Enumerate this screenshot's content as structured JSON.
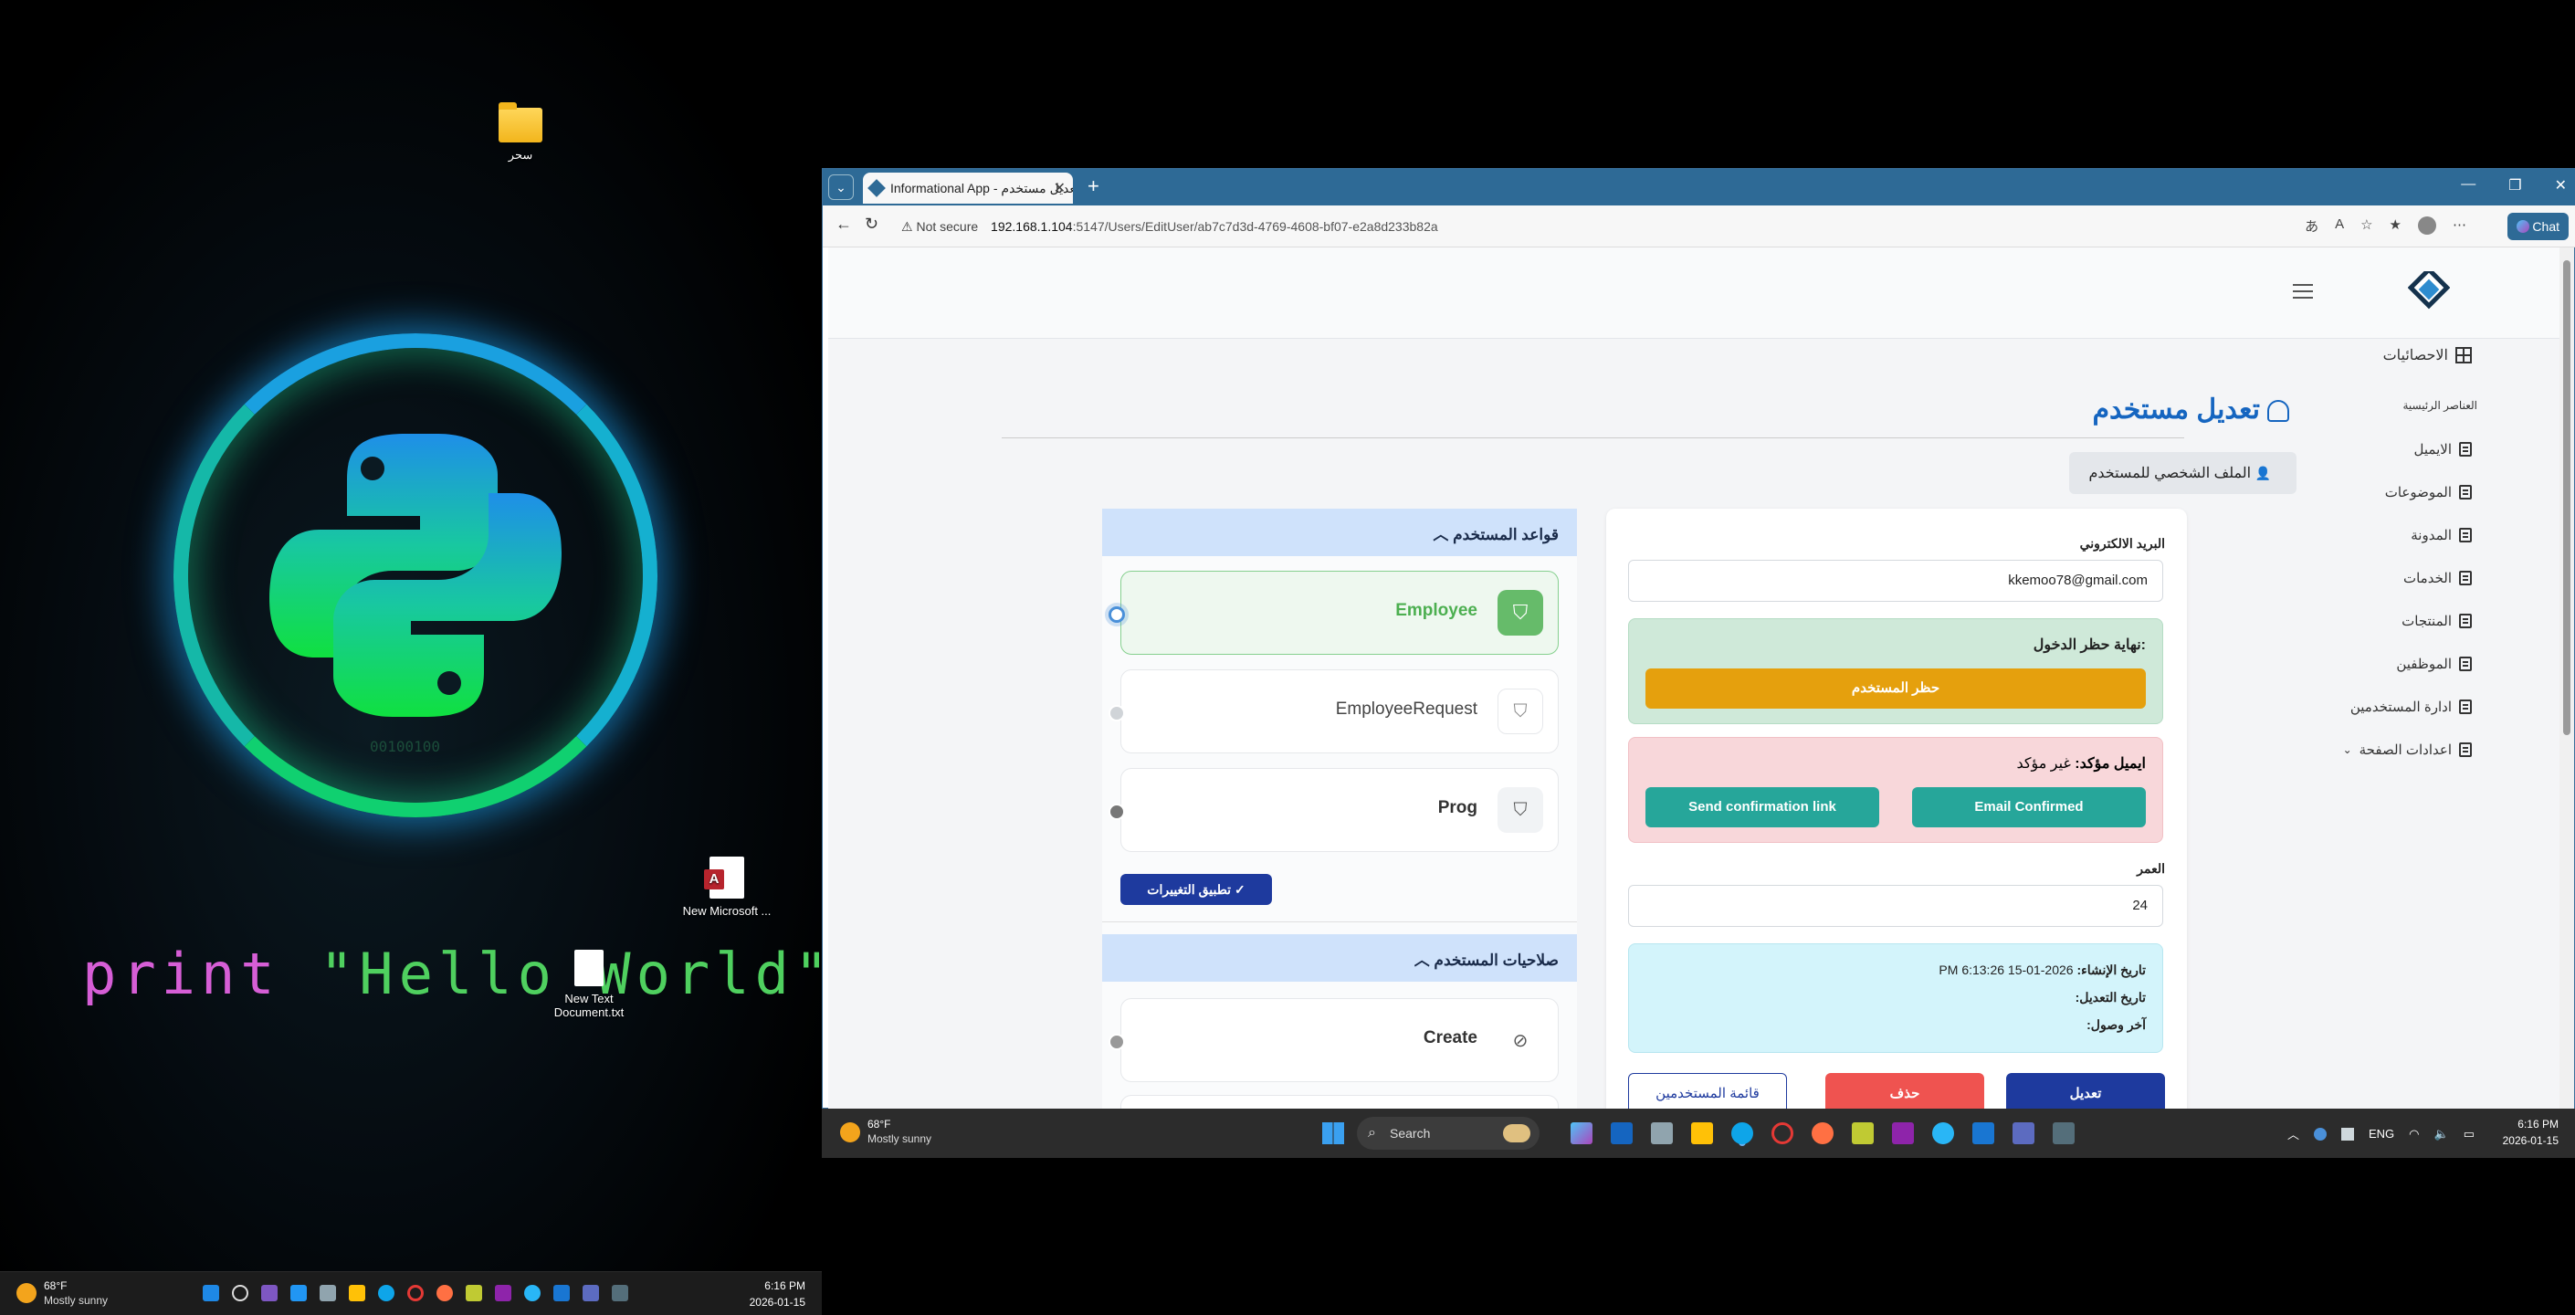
{
  "left_desktop": {
    "folder_label": "سحر",
    "code_text": "print ",
    "code_string": "\"Hello World\"",
    "access_icon_label": "New Microsoft ...",
    "text_doc_label": "New Text Document.txt",
    "ring_caption": "00100100"
  },
  "left_taskbar": {
    "weather_temp": "68°F",
    "weather_desc": "Mostly sunny",
    "time": "6:16 PM",
    "date": "2026-01-15"
  },
  "browser": {
    "tab_title": "Informational App - تعديل مستخدم",
    "not_secure": "Not secure",
    "url_host": "192.168.1.104",
    "url_path": ":5147/Users/EditUser/ab7c7d3d-4769-4608-bf07-e2a8d233b82a",
    "chat_label": "Chat"
  },
  "sidebar": {
    "stats": "الاحصائيات",
    "section_heading": "العناصر الرئيسية",
    "items": [
      "الايميل",
      "الموضوعات",
      "المدونة",
      "الخدمات",
      "المنتجات",
      "الموظفين",
      "ادارة المستخدمين"
    ],
    "page_settings": "اعدادات الصفحة"
  },
  "page": {
    "title": "تعديل مستخدم",
    "profile_tab": "الملف الشخصي للمستخدم"
  },
  "form": {
    "email_label": "البريد الالكتروني",
    "email_value": "kkemoo78@gmail.com",
    "lockout_label": "نهاية حظر الدخول:",
    "block_button": "حظر المستخدم",
    "email_confirmed_label": "ايميل مؤكد:",
    "email_confirmed_value": "غير مؤكد",
    "send_link_button": "Send confirmation link",
    "email_confirmed_button": "Email Confirmed",
    "age_label": "العمر",
    "age_value": "24",
    "created_label": "تاريخ الإنشاء:",
    "created_value": "2026-01-15 6:13:26 PM",
    "modified_label": "تاريخ التعديل:",
    "last_seen_label": "آخر وصول:",
    "edit_button": "تعديل",
    "delete_button": "حذف",
    "users_list_button": "قائمة المستخدمين"
  },
  "roles": {
    "heading": "قواعد المستخدم",
    "items": [
      {
        "name": "Employee",
        "selected": true
      },
      {
        "name": "EmployeeRequest",
        "selected": false
      },
      {
        "name": "Prog",
        "selected": false
      }
    ],
    "apply_button": "تطبيق التغييرات"
  },
  "permissions": {
    "heading": "صلاحيات المستخدم",
    "items": [
      {
        "name": "Create"
      }
    ]
  },
  "right_taskbar": {
    "weather_temp": "68°F",
    "weather_desc": "Mostly sunny",
    "search_placeholder": "Search",
    "lang": "ENG",
    "time": "6:16 PM",
    "date": "2026-01-15"
  },
  "colors": {
    "primary_blue": "#1e3a9e",
    "title_blue": "#1565c0",
    "orange": "#e5a00d",
    "teal": "#26a69a",
    "red": "#ef5350",
    "success_green": "#4caf50"
  }
}
